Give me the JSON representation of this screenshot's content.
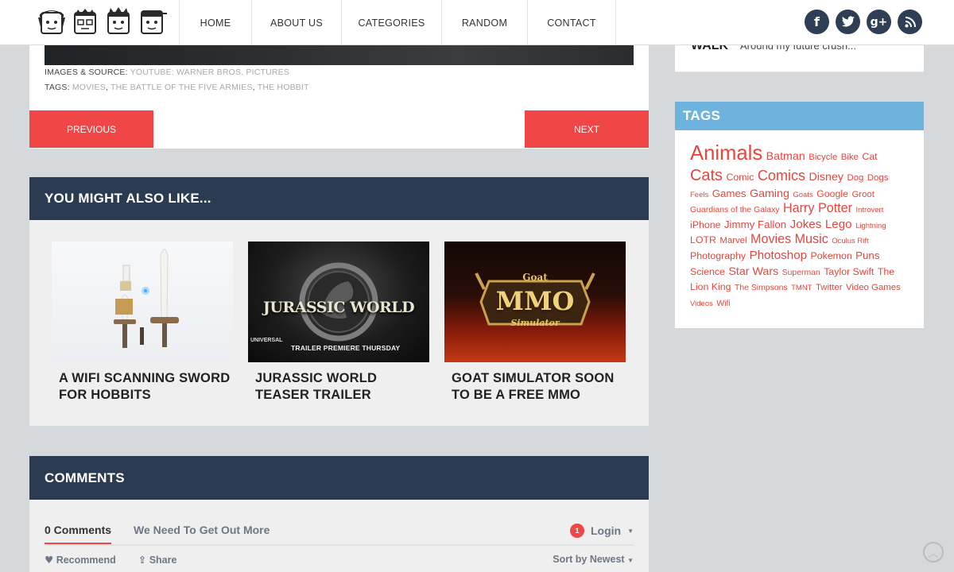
{
  "nav": {
    "items": [
      {
        "label": "HOME"
      },
      {
        "label": "ABOUT US"
      },
      {
        "label": "CATEGORIES"
      },
      {
        "label": "RANDOM"
      },
      {
        "label": "CONTACT"
      }
    ]
  },
  "social": {
    "facebook": "f",
    "twitter": "t",
    "google": "g+",
    "rss": "rss"
  },
  "article": {
    "source_label": "IMAGES & SOURCE:",
    "source_value": "YOUTUBE: WARNER BROS. PICTURES",
    "tags_label": "TAGS:",
    "tags": [
      "MOVIES",
      "THE BATTLE OF THE FIVE ARMIES",
      "THE HOBBIT"
    ],
    "prev_label": "PREVIOUS",
    "next_label": "NEXT"
  },
  "related": {
    "heading": "YOU MIGHT ALSO LIKE...",
    "cards": [
      {
        "title": "A WIFI SCANNING SWORD FOR HOBBITS"
      },
      {
        "title": "JURASSIC WORLD TEASER TRAILER",
        "thumb_text": "JURASSIC WORLD",
        "thumb_sub": "TRAILER PREMIERE THURSDAY",
        "thumb_brand": "UNIVERSAL"
      },
      {
        "title": "GOAT SIMULATOR SOON TO BE A FREE MMO",
        "thumb_top": "Goat",
        "thumb_main": "MMO",
        "thumb_sub": "Simulator"
      }
    ]
  },
  "comments": {
    "heading": "COMMENTS",
    "tab_count": "0 Comments",
    "tab_site": "We Need To Get Out More",
    "notif_count": "1",
    "login": "Login",
    "recommend": "Recommend",
    "share": "Share",
    "sort": "Sort by Newest"
  },
  "sidebar": {
    "top_label": "WALK",
    "top_text": "Around my future crush...",
    "tags_heading": "TAGS",
    "tags": [
      {
        "t": "Animals",
        "s": 27
      },
      {
        "t": "Batman",
        "s": 15
      },
      {
        "t": "Bicycle",
        "s": 12
      },
      {
        "t": "Bike",
        "s": 12
      },
      {
        "t": "Cat",
        "s": 13
      },
      {
        "t": "Cats",
        "s": 21
      },
      {
        "t": "Comic",
        "s": 13
      },
      {
        "t": "Comics",
        "s": 19
      },
      {
        "t": "Disney",
        "s": 15
      },
      {
        "t": "Dog",
        "s": 12
      },
      {
        "t": "Dogs",
        "s": 12
      },
      {
        "t": "Feels",
        "s": 10
      },
      {
        "t": "Games",
        "s": 14
      },
      {
        "t": "Gaming",
        "s": 15
      },
      {
        "t": "Goats",
        "s": 10
      },
      {
        "t": "Google",
        "s": 13
      },
      {
        "t": "Groot",
        "s": 12
      },
      {
        "t": "Guardians of the Galaxy",
        "s": 11
      },
      {
        "t": "Harry Potter",
        "s": 17
      },
      {
        "t": "Introvert",
        "s": 10
      },
      {
        "t": "iPhone",
        "s": 13
      },
      {
        "t": "Jimmy Fallon",
        "s": 14
      },
      {
        "t": "Jokes",
        "s": 16
      },
      {
        "t": "Lego",
        "s": 16
      },
      {
        "t": "Lightning",
        "s": 10
      },
      {
        "t": "LOTR",
        "s": 13
      },
      {
        "t": "Marvel",
        "s": 12
      },
      {
        "t": "Movies",
        "s": 17
      },
      {
        "t": "Music",
        "s": 17
      },
      {
        "t": "Oculus Rift",
        "s": 10
      },
      {
        "t": "Photography",
        "s": 13
      },
      {
        "t": "Photoshop",
        "s": 16
      },
      {
        "t": "Pokemon",
        "s": 13
      },
      {
        "t": "Puns",
        "s": 14
      },
      {
        "t": "Science",
        "s": 13
      },
      {
        "t": "Star Wars",
        "s": 15
      },
      {
        "t": "Superman",
        "s": 11
      },
      {
        "t": "Taylor Swift",
        "s": 13
      },
      {
        "t": "The Lion King",
        "s": 13
      },
      {
        "t": "The Simpsons",
        "s": 11
      },
      {
        "t": "TMNT",
        "s": 10
      },
      {
        "t": "Twitter",
        "s": 12
      },
      {
        "t": "Video Games",
        "s": 12
      },
      {
        "t": "Videos",
        "s": 10
      },
      {
        "t": "Wifi",
        "s": 11
      }
    ]
  },
  "colors": {
    "accent_red": "#f04646",
    "navy": "#2b3b51",
    "tags_blue": "#6db3dd",
    "tag_red": "#e8453c"
  }
}
